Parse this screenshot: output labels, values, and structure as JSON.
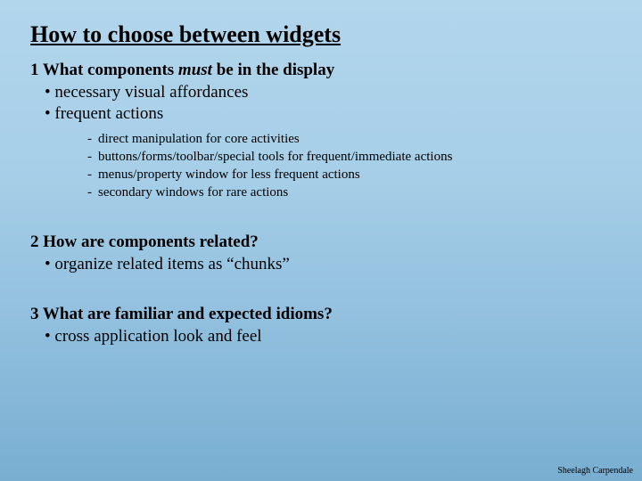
{
  "title": "How to choose between widgets",
  "sections": [
    {
      "heading_pre": "1 What components ",
      "heading_em": "must",
      "heading_post": " be in the display",
      "bullets": [
        "• necessary visual affordances",
        "• frequent actions"
      ],
      "subbullets": [
        "direct manipulation for core activities",
        "buttons/forms/toolbar/special tools for frequent/immediate actions",
        "menus/property window for less frequent actions",
        "secondary windows for rare actions"
      ]
    },
    {
      "heading_pre": "2 How are components related?",
      "heading_em": "",
      "heading_post": "",
      "bullets": [
        "• organize related items as “chunks”"
      ],
      "subbullets": []
    },
    {
      "heading_pre": "3 What are familiar and expected idioms?",
      "heading_em": "",
      "heading_post": "",
      "bullets": [
        "• cross application look and feel"
      ],
      "subbullets": []
    }
  ],
  "footer": "Sheelagh Carpendale"
}
